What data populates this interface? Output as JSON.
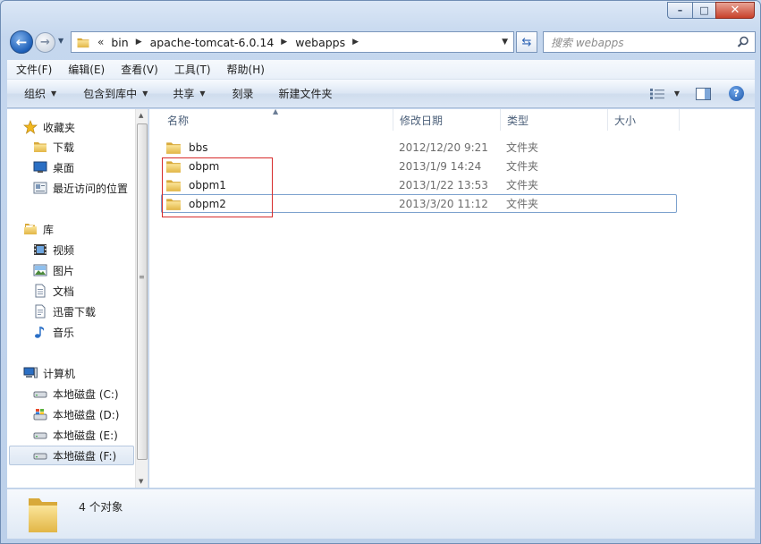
{
  "window": {
    "controls": {
      "minimize": "–",
      "maximize": "□",
      "close": "✕"
    }
  },
  "nav": {
    "back": "←",
    "forward": "→",
    "breadcrumb_overflow": "«",
    "breadcrumbs": [
      "bin",
      "apache-tomcat-6.0.14",
      "webapps"
    ],
    "search_placeholder": "搜索 webapps"
  },
  "menu": [
    "文件(F)",
    "编辑(E)",
    "查看(V)",
    "工具(T)",
    "帮助(H)"
  ],
  "toolbar": {
    "organize": "组织",
    "include_library": "包含到库中",
    "share": "共享",
    "burn": "刻录",
    "new_folder": "新建文件夹",
    "help": "?"
  },
  "sidebar": {
    "favorites": {
      "label": "收藏夹",
      "items": [
        "下载",
        "桌面",
        "最近访问的位置"
      ]
    },
    "libraries": {
      "label": "库",
      "items": [
        "视频",
        "图片",
        "文档",
        "迅雷下载",
        "音乐"
      ]
    },
    "computer": {
      "label": "计算机",
      "items": [
        "本地磁盘 (C:)",
        "本地磁盘 (D:)",
        "本地磁盘 (E:)",
        "本地磁盘 (F:)"
      ],
      "selected": "本地磁盘 (F:)"
    }
  },
  "columns": {
    "name": "名称",
    "modified": "修改日期",
    "type": "类型",
    "size": "大小"
  },
  "files": [
    {
      "name": "bbs",
      "modified": "2012/12/20 9:21",
      "type": "文件夹"
    },
    {
      "name": "obpm",
      "modified": "2013/1/9 14:24",
      "type": "文件夹"
    },
    {
      "name": "obpm1",
      "modified": "2013/1/22 13:53",
      "type": "文件夹"
    },
    {
      "name": "obpm2",
      "modified": "2013/3/20 11:12",
      "type": "文件夹"
    }
  ],
  "status": {
    "count": "4 个对象"
  },
  "colors": {
    "highlight_box": "#d72b2b",
    "folder": "#e8c050",
    "accent": "#1d5fb8"
  }
}
